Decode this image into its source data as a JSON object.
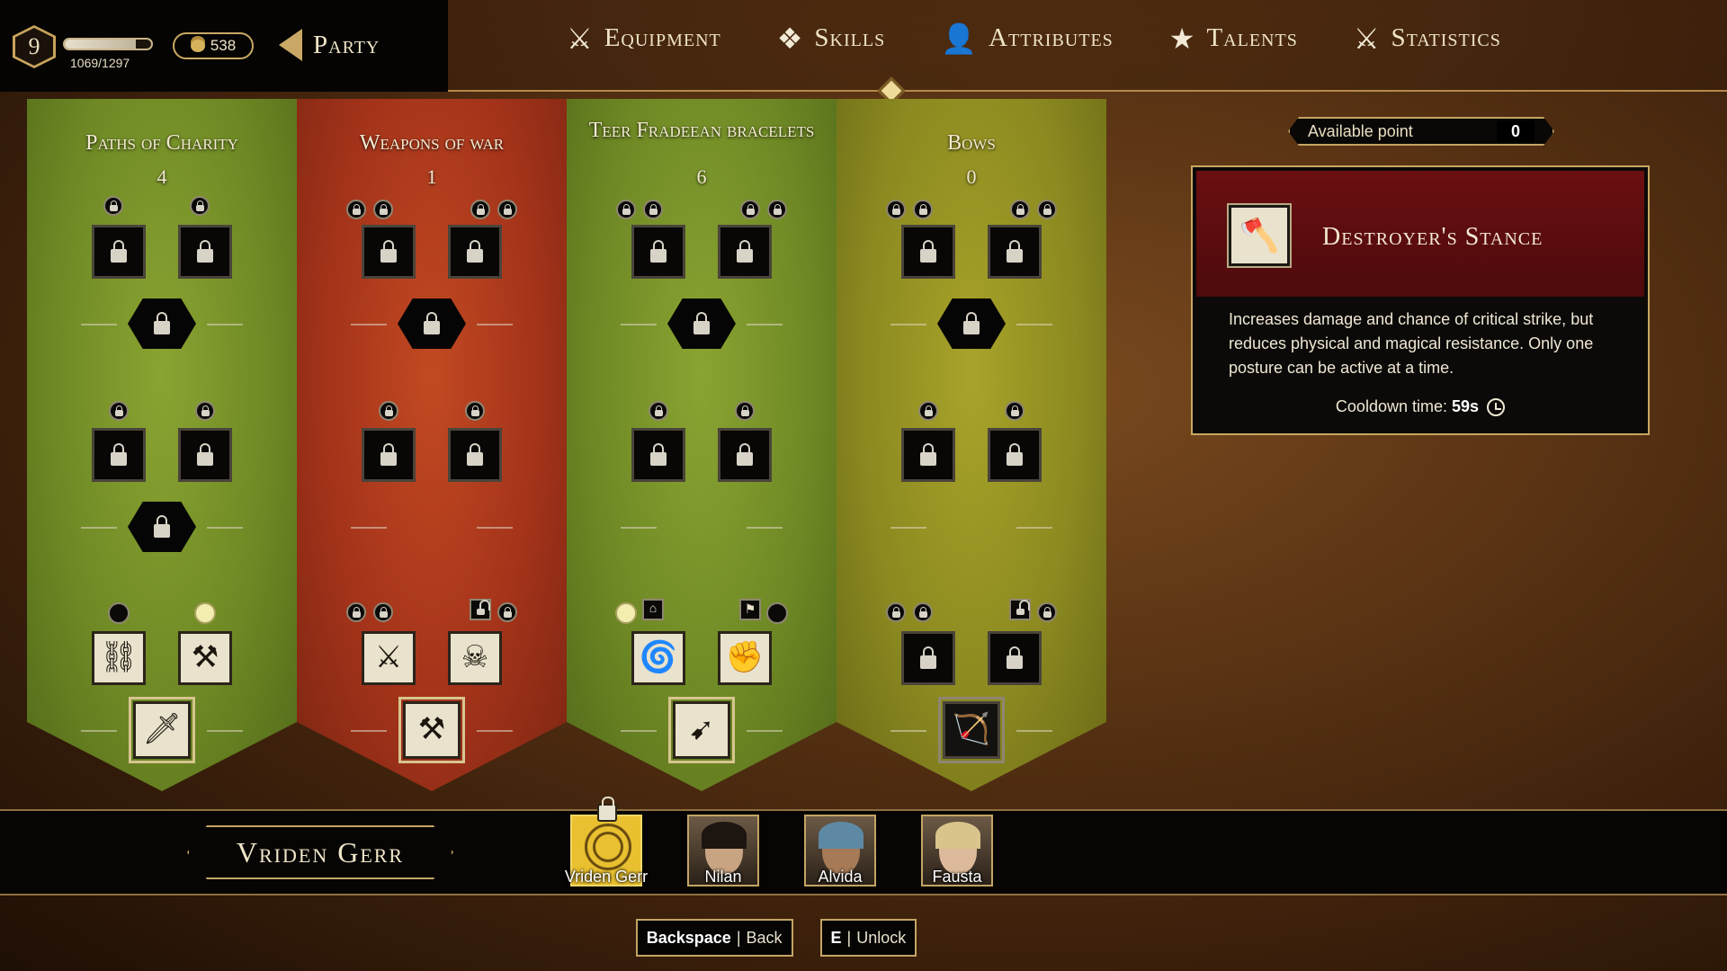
{
  "header": {
    "level": "9",
    "xp": {
      "current": 1069,
      "max": 1297,
      "text": "1069/1297",
      "fraction": 0.82
    },
    "gold": "538",
    "party_label": "Party",
    "nav": [
      {
        "label": "Equipment",
        "icon": "crossed-swords-icon",
        "active": false
      },
      {
        "label": "Skills",
        "icon": "skills-orbs-icon",
        "active": true
      },
      {
        "label": "Attributes",
        "icon": "person-icon",
        "active": false
      },
      {
        "label": "Talents",
        "icon": "star-icon",
        "active": false
      },
      {
        "label": "Statistics",
        "icon": "crossed-swords-icon",
        "active": false
      }
    ]
  },
  "trees": [
    {
      "title": "Paths of Charity",
      "points": "4",
      "color": "green",
      "top_nodes": [
        "locked",
        "locked"
      ],
      "mid_nodes": [
        "locked",
        "locked"
      ],
      "bottom_nodes": [
        {
          "state": "unlocked",
          "glyph": "cage"
        },
        {
          "state": "unlocked",
          "glyph": "hammer-warrior"
        }
      ],
      "capstone": {
        "state": "unlocked",
        "glyph": "warrior-strike"
      }
    },
    {
      "title": "Weapons of war",
      "points": "1",
      "color": "red",
      "top_nodes": [
        "locked",
        "locked"
      ],
      "mid_nodes": [
        "locked",
        "locked"
      ],
      "bottom_nodes": [
        {
          "state": "unlocked",
          "glyph": "charge"
        },
        {
          "state": "unlocked",
          "glyph": "reaper"
        }
      ],
      "capstone": {
        "state": "unlocked",
        "glyph": "weapons"
      }
    },
    {
      "title": "Teer Fradeean bracelets",
      "points": "6",
      "color": "green",
      "top_nodes": [
        "locked",
        "locked"
      ],
      "mid_nodes": [
        "locked",
        "locked"
      ],
      "bottom_nodes": [
        {
          "state": "unlocked",
          "glyph": "whirlwind"
        },
        {
          "state": "unlocked",
          "glyph": "fists"
        }
      ],
      "capstone": {
        "state": "unlocked",
        "glyph": "dodge"
      }
    },
    {
      "title": "Bows",
      "points": "0",
      "color": "yellow",
      "top_nodes": [
        "locked",
        "locked"
      ],
      "mid_nodes": [
        "locked",
        "locked"
      ],
      "bottom_nodes": [
        {
          "state": "locked"
        },
        {
          "state": "locked"
        }
      ],
      "capstone": {
        "state": "available",
        "glyph": "archer"
      }
    }
  ],
  "available_points": {
    "label": "Available point",
    "value": "0"
  },
  "skill_detail": {
    "title": "Destroyer's Stance",
    "description": "Increases damage and chance of critical strike, but reduces physical and magical resistance. Only one posture can be active at a time.",
    "cooldown_label": "Cooldown time:",
    "cooldown_value": "59s"
  },
  "character": {
    "selected_name": "Vriden Gerr",
    "party": [
      {
        "name": "Vriden Gerr",
        "active": true,
        "locked": true
      },
      {
        "name": "Nilan",
        "active": false
      },
      {
        "name": "Alvida",
        "active": false
      },
      {
        "name": "Fausta",
        "active": false
      }
    ]
  },
  "footer": {
    "back": {
      "key": "Backspace",
      "label": "Back"
    },
    "unlock": {
      "key": "E",
      "label": "Unlock"
    },
    "separator": "|"
  },
  "colors": {
    "accent_gold": "#c3a464",
    "tree_green": "#6f8a25",
    "tree_red": "#a4331a",
    "tree_yellow": "#8c8a20",
    "detail_header": "#6b0f12"
  }
}
